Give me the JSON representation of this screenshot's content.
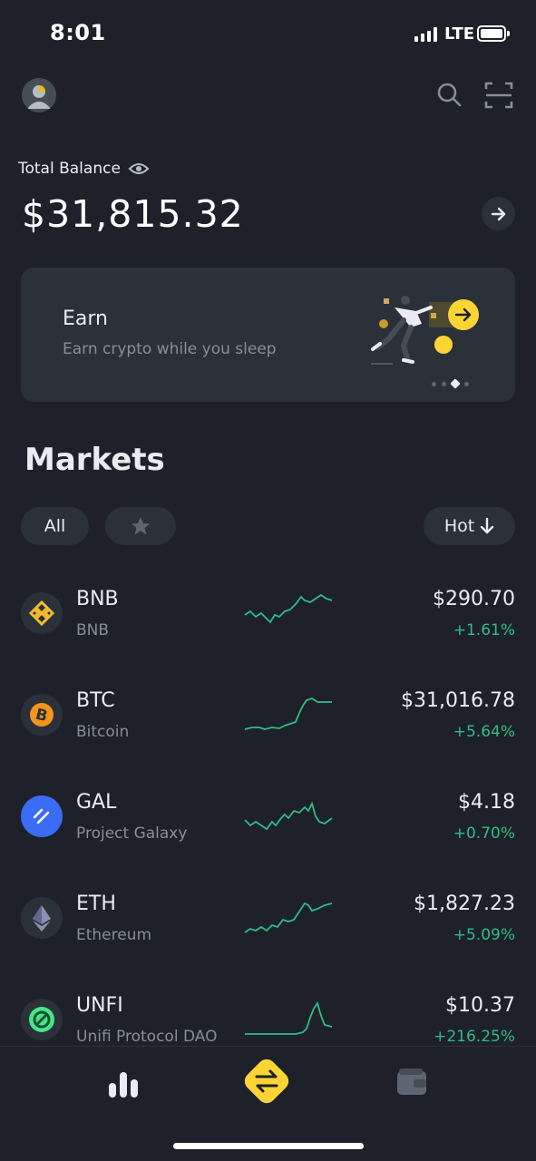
{
  "status_bar": {
    "time": "8:01",
    "network": "LTE"
  },
  "header": {
    "avatar_icon": "user-avatar-icon",
    "search_icon": "search-icon",
    "scan_icon": "scan-icon"
  },
  "balance": {
    "label": "Total Balance",
    "value": "$31,815.32",
    "visibility_icon": "eye-icon",
    "action_icon": "arrow-right-icon"
  },
  "banner": {
    "title": "Earn",
    "subtitle": "Earn crypto while you sleep",
    "active_dot": 3,
    "dot_count": 4
  },
  "markets": {
    "title": "Markets",
    "filters": {
      "all": "All",
      "favorites_icon": "star-icon",
      "sort": "Hot"
    },
    "rows": [
      {
        "symbol": "BNB",
        "name": "BNB",
        "price": "$290.70",
        "change": "+1.61%",
        "color": "#f3ba2f"
      },
      {
        "symbol": "BTC",
        "name": "Bitcoin",
        "price": "$31,016.78",
        "change": "+5.64%",
        "color": "#f7931a"
      },
      {
        "symbol": "GAL",
        "name": "Project Galaxy",
        "price": "$4.18",
        "change": "+0.70%",
        "color": "#3b6cf5"
      },
      {
        "symbol": "ETH",
        "name": "Ethereum",
        "price": "$1,827.23",
        "change": "+5.09%",
        "color": "#8a92b2"
      },
      {
        "symbol": "UNFI",
        "name": "Unifi Protocol DAO",
        "price": "$10.37",
        "change": "+216.25%",
        "color": "#47e58b"
      }
    ]
  },
  "bottom_nav": {
    "markets_icon": "bar-chart-icon",
    "trade_icon": "swap-arrows-icon",
    "wallet_icon": "wallet-icon"
  },
  "colors": {
    "accent": "#fcd535",
    "positive": "#2ebd85",
    "background": "#1e2129",
    "card": "#2b3139"
  }
}
